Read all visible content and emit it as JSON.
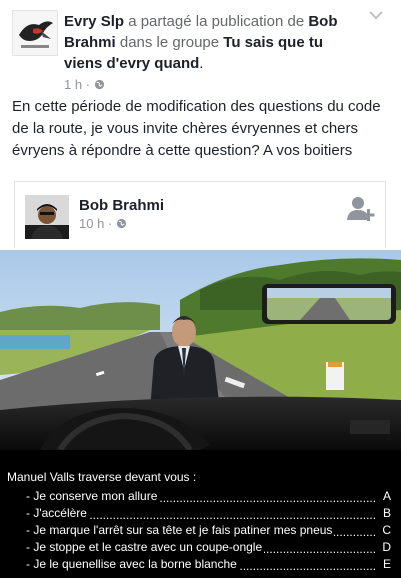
{
  "post": {
    "author": "Evry Slp",
    "action": " a partagé la publication de ",
    "shared_from": "Bob Brahmi",
    "in_group": " dans le groupe ",
    "group": "Tu sais que tu viens d'evry quand",
    "period": ".",
    "time": "1 h",
    "privacy_sep": " · ",
    "text": "En cette période de modification des questions du code de la route, je vous invite chères évryennes et chers évryens à répondre à cette question? A vos boitiers"
  },
  "shared_card": {
    "name": "Bob Brahmi",
    "time": "10 h",
    "privacy_sep": " · "
  },
  "question": {
    "title": "Manuel Valls traverse devant vous :",
    "options": [
      {
        "text": "- Je conserve mon allure",
        "letter": "A"
      },
      {
        "text": "- J'accélère",
        "letter": "B"
      },
      {
        "text": "- Je marque l'arrêt sur sa tête et je fais patiner mes pneus",
        "letter": "C"
      },
      {
        "text": "- Je stoppe et le castre avec un coupe-ongle",
        "letter": "D"
      },
      {
        "text": "- Je le quenellise avec la borne blanche",
        "letter": "E"
      }
    ]
  },
  "colors": {
    "link": "#1d2129",
    "meta": "#90949c",
    "question_bg": "#000000"
  },
  "icons": [
    "chevron-down-icon",
    "globe-icon",
    "add-friend-icon"
  ]
}
